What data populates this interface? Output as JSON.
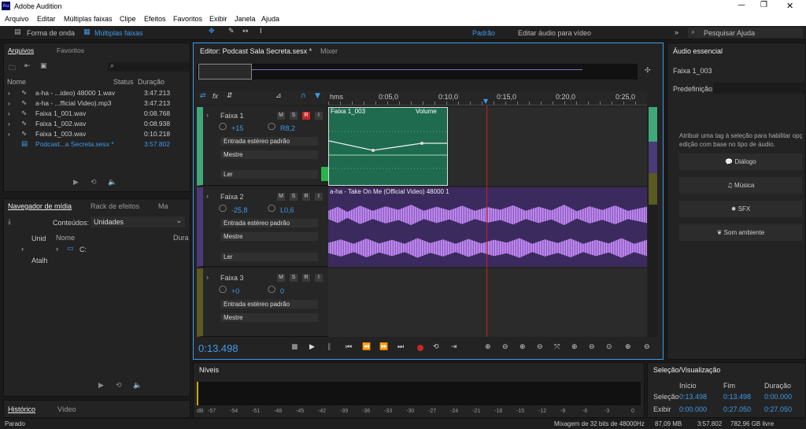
{
  "window": {
    "title": "Adobe Audition",
    "logo": "Au"
  },
  "menu": [
    "Arquivo",
    "Editar",
    "Múltiplas faixas",
    "Clipe",
    "Efeitos",
    "Favoritos",
    "Exibir",
    "Janela",
    "Ajuda"
  ],
  "toolbar": {
    "waveform": "Forma de onda",
    "multitrack": "Múltiplas faixas",
    "workspace": "Padrão",
    "edit_video": "Editar áudio para vídeo",
    "search_placeholder": "Pesquisar Ajuda"
  },
  "files": {
    "tab1": "Arquivos",
    "tab2": "Favoritos",
    "col_name": "Nome",
    "col_status": "Status",
    "col_duration": "Duração",
    "items": [
      {
        "name": "a-ha - ...ideo) 48000 1.wav",
        "duration": "3:47.213"
      },
      {
        "name": "a-ha - ...fficial Video).mp3",
        "duration": "3:47.213"
      },
      {
        "name": "Faixa 1_001.wav",
        "duration": "0:08.768"
      },
      {
        "name": "Faixa 1_002.wav",
        "duration": "0:08.938"
      },
      {
        "name": "Faixa 1_003.wav",
        "duration": "0:10.218"
      },
      {
        "name": "Podcast...a Secreta.sesx *",
        "duration": "3:57.802"
      }
    ]
  },
  "media": {
    "tab1": "Navegador de mídia",
    "tab2": "Rack de efeitos",
    "tab3": "Ma",
    "contents_label": "Conteúdos:",
    "contents_value": "Unidades",
    "col_name": "Nome",
    "col_dur": "Dura",
    "tree1": "Unid",
    "tree2": "Atalh",
    "drive": "C:"
  },
  "history": {
    "tab1": "Histórico",
    "tab2": "Vídeo"
  },
  "status": {
    "left": "Parado",
    "mix": "Mixagem de 32 bits de 48000Hz",
    "size": "87,09 MB",
    "dur": "3:57.802",
    "free": "782,96 GB livre"
  },
  "editor": {
    "tab": "Editor: Podcast Sala Secreta.sesx *",
    "mixer": "Mixer",
    "time": "0:13.498",
    "ruler": [
      "hms",
      "0:05,0",
      "0:10,0",
      "0:15,0",
      "0:20,0",
      "0:25,0"
    ],
    "tracks": [
      {
        "name": "Faixa 1",
        "vol": "+15",
        "pan": "R8,2",
        "input": "Entrada estéreo padrão",
        "output": "Mestre",
        "mode": "Ler"
      },
      {
        "name": "Faixa 2",
        "vol": "-25,8",
        "pan": "L0,6",
        "input": "Entrada estéreo padrão",
        "output": "Mestre",
        "mode": "Ler"
      },
      {
        "name": "Faixa 3",
        "vol": "+0",
        "pan": "0",
        "input": "Entrada estéreo padrão",
        "output": "Mestre"
      }
    ],
    "clip1": {
      "name": "Faixa 1_003",
      "envelope": "Volume"
    },
    "clip2": {
      "name": "a-ha - Take On Me (Official Video) 48000 1"
    }
  },
  "levels": {
    "title": "Níveis",
    "scale": [
      "dB",
      "-57",
      "-54",
      "-51",
      "-48",
      "-45",
      "-42",
      "-39",
      "-36",
      "-33",
      "-30",
      "-27",
      "-24",
      "-21",
      "-18",
      "-15",
      "-12",
      "-9",
      "-6",
      "-3",
      "0"
    ]
  },
  "essential": {
    "title": "Áudio essencial",
    "clip": "Faixa 1_003",
    "preset_label": "Predefinição:",
    "hint1": "Atribuir uma tag à seleção para habilitar opç",
    "hint2": "edição com base no tipo de áudio.",
    "buttons": [
      "Diálogo",
      "Música",
      "SFX",
      "Som ambiente"
    ]
  },
  "selection": {
    "title": "Seleção/Visualização",
    "col1": "Início",
    "col2": "Fim",
    "col3": "Duração",
    "row1": "Seleção",
    "row2": "Exibir",
    "sel_start": "0:13.498",
    "sel_end": "0:13.498",
    "sel_dur": "0:00.000",
    "view_start": "0:00.000",
    "view_end": "0:27.050",
    "view_dur": "0:27.050"
  },
  "colors": {
    "accent": "#3f9ae8",
    "clip_green": "#1e6b4f",
    "clip_purple": "#3b2a5e",
    "wave_purple": "#b07ae0",
    "record": "#c62828",
    "playhead": "#d02020"
  }
}
